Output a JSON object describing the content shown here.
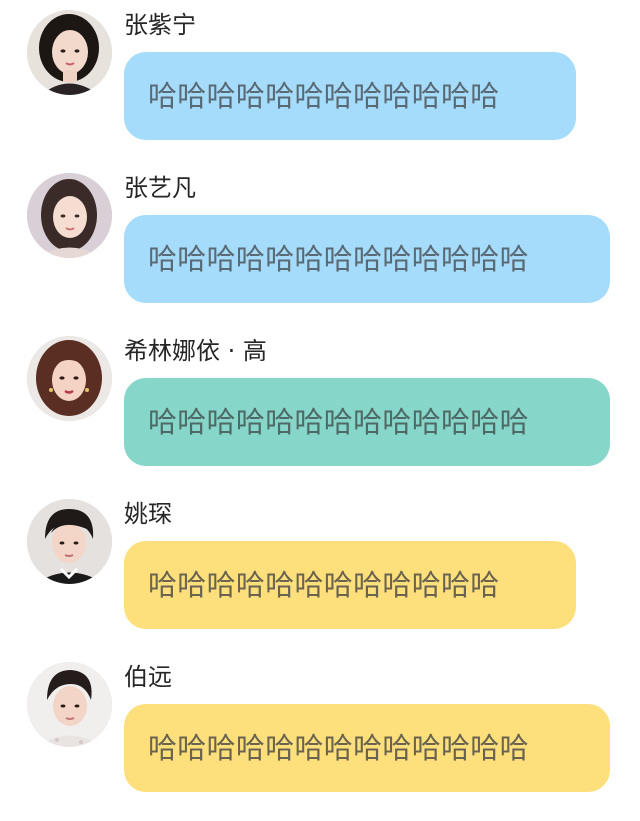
{
  "messages": [
    {
      "name": "张紫宁",
      "text": "哈哈哈哈哈哈哈哈哈哈哈哈",
      "bubble_color": "#a6dcfb",
      "avatar": "avatar-woman-dark-hair-icon"
    },
    {
      "name": "张艺凡",
      "text": "哈哈哈哈哈哈哈哈哈哈哈哈哈",
      "bubble_color": "#a6dcfb",
      "avatar": "avatar-woman-long-hair-icon"
    },
    {
      "name": "希林娜依 · 高",
      "text": "哈哈哈哈哈哈哈哈哈哈哈哈哈",
      "bubble_color": "#86d6c9",
      "avatar": "avatar-woman-auburn-hair-icon"
    },
    {
      "name": "姚琛",
      "text": "哈哈哈哈哈哈哈哈哈哈哈哈",
      "bubble_color": "#fde07b",
      "avatar": "avatar-man-dark-hair-icon"
    },
    {
      "name": "伯远",
      "text": "哈哈哈哈哈哈哈哈哈哈哈哈哈",
      "bubble_color": "#fde07b",
      "avatar": "avatar-man-short-hair-icon"
    }
  ]
}
